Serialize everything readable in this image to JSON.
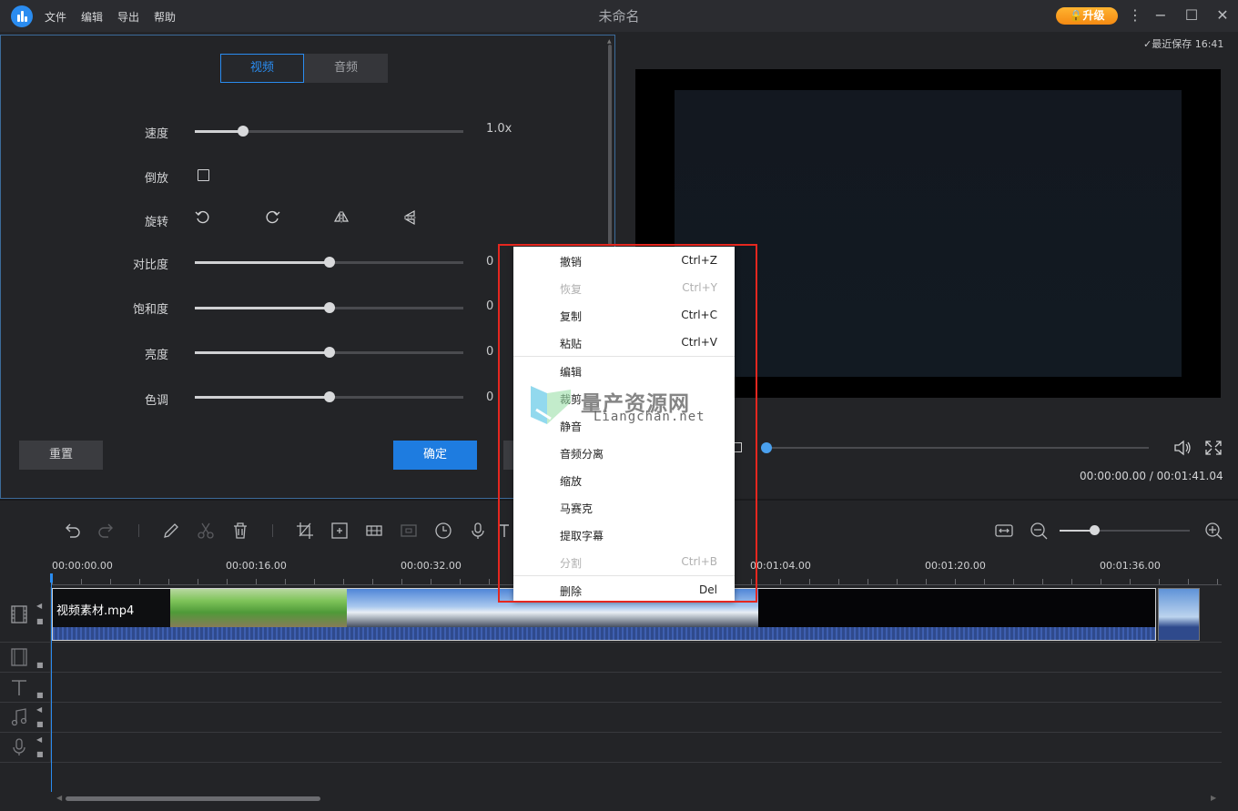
{
  "app": {
    "title": "未命名",
    "menus": [
      "文件",
      "编辑",
      "导出",
      "帮助"
    ],
    "upgrade_label": "升级",
    "last_saved": "最近保存 16:41"
  },
  "settings": {
    "tabs": [
      {
        "label": "视频",
        "active": true
      },
      {
        "label": "音频",
        "active": false
      }
    ],
    "speed": {
      "label": "速度",
      "value": "1.0x",
      "level": 0.18
    },
    "reverse": {
      "label": "倒放",
      "checked": false
    },
    "rotate": {
      "label": "旋转"
    },
    "contrast": {
      "label": "对比度",
      "value": "0",
      "level": 0.5
    },
    "saturation": {
      "label": "饱和度",
      "value": "0",
      "level": 0.5
    },
    "brightness": {
      "label": "亮度",
      "value": "0",
      "level": 0.5
    },
    "hue": {
      "label": "色调",
      "value": "0",
      "level": 0.5
    },
    "reset_label": "重置",
    "ok_label": "确定"
  },
  "preview": {
    "time_current": "00:00:00.00",
    "time_total": "00:01:41.04",
    "time_display": "00:00:00.00 / 00:01:41.04"
  },
  "timeline": {
    "ruler_labels": [
      "00:00:00.00",
      "00:00:16.00",
      "00:00:32.00",
      "00:01:04.00",
      "00:01:20.00",
      "00:01:36.00"
    ],
    "clip_name": "视频素材.mp4"
  },
  "context_menu": {
    "items": [
      {
        "label": "撤销",
        "shortcut": "Ctrl+Z",
        "disabled": false
      },
      {
        "label": "恢复",
        "shortcut": "Ctrl+Y",
        "disabled": true
      },
      {
        "label": "复制",
        "shortcut": "Ctrl+C",
        "disabled": false
      },
      {
        "label": "粘贴",
        "shortcut": "Ctrl+V",
        "disabled": false
      },
      {
        "label": "编辑",
        "shortcut": "",
        "disabled": false
      },
      {
        "label": "裁剪",
        "shortcut": "",
        "disabled": false
      },
      {
        "label": "静音",
        "shortcut": "",
        "disabled": false
      },
      {
        "label": "音频分离",
        "shortcut": "",
        "disabled": false
      },
      {
        "label": "缩放",
        "shortcut": "",
        "disabled": false
      },
      {
        "label": "马赛克",
        "shortcut": "",
        "disabled": false
      },
      {
        "label": "提取字幕",
        "shortcut": "",
        "disabled": false
      },
      {
        "label": "分割",
        "shortcut": "Ctrl+B",
        "disabled": true
      },
      {
        "label": "删除",
        "shortcut": "Del",
        "disabled": false
      }
    ]
  },
  "watermark": {
    "title": "量产资源网",
    "subtitle": "Liangchan.net"
  },
  "colors": {
    "accent": "#2a8cf0",
    "upgrade": "#f5a020",
    "highlight_box": "#e5271f",
    "background": "#232427"
  }
}
